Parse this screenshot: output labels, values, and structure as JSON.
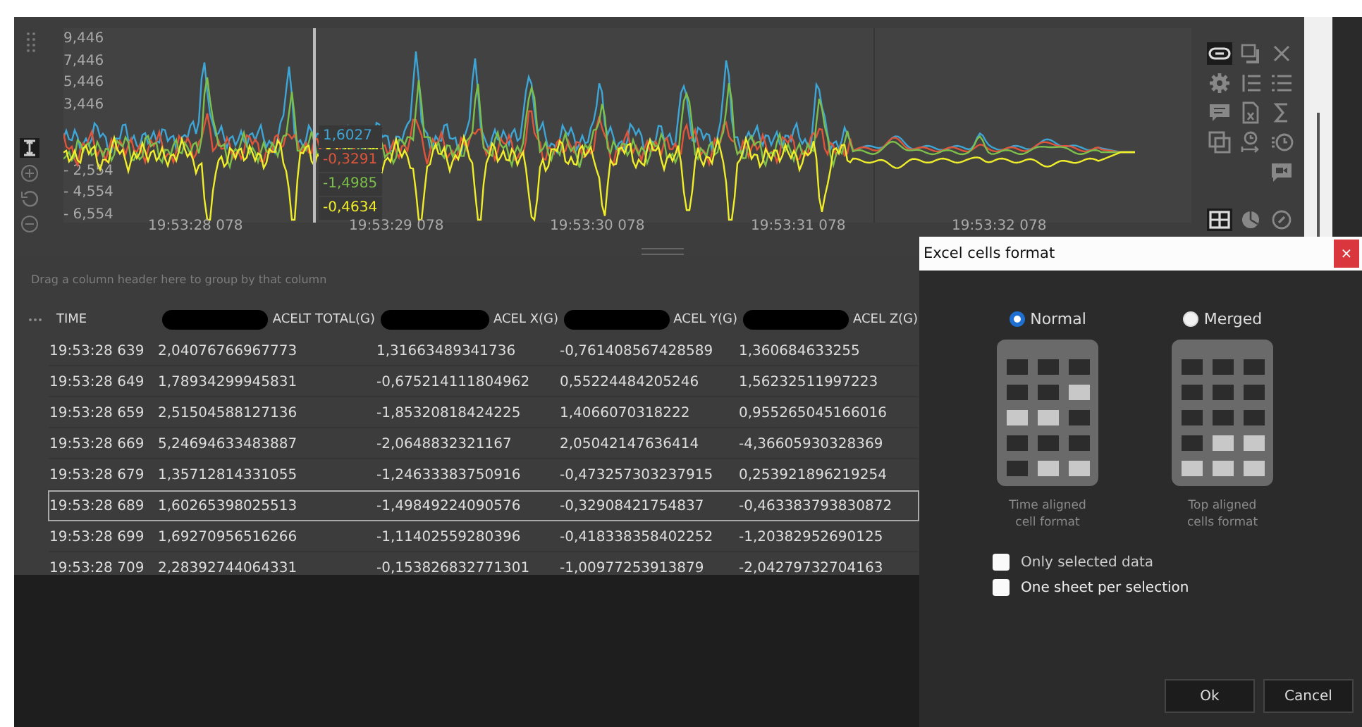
{
  "chart": {
    "y_labels": [
      "9,446",
      "7,446",
      "5,446",
      "3,446",
      "- 2,554",
      "- 4,554",
      "- 6,554"
    ],
    "x_labels": [
      "19:53:28 078",
      "19:53:29 078",
      "19:53:30 078",
      "19:53:31 078",
      "19:53:32 078"
    ],
    "series": [
      {
        "color": "#3ea6d6",
        "readout": "1,6027"
      },
      {
        "color": "#e0553a",
        "readout": "-0,3291"
      },
      {
        "color": "#7cbf4a",
        "readout": "-1,4985"
      },
      {
        "color": "#f0ee2a",
        "readout": "-0,4634"
      }
    ]
  },
  "tool_states": {
    "cursor": true,
    "link": true,
    "table_view": true
  },
  "group_hint": "Drag a column header here to group by that column",
  "columns": [
    {
      "label": "TIME",
      "redacted": false
    },
    {
      "label": "ACELT TOTAL(G)",
      "redacted": true
    },
    {
      "label": "ACEL X(G)",
      "redacted": true
    },
    {
      "label": "ACEL Y(G)",
      "redacted": true
    },
    {
      "label": "ACEL Z(G)",
      "redacted": true
    }
  ],
  "rows": [
    {
      "cells": [
        "19:53:28 639",
        "2,04076766967773",
        "1,31663489341736",
        "-0,761408567428589",
        "1,360684633255"
      ],
      "selected": false
    },
    {
      "cells": [
        "19:53:28 649",
        "1,78934299945831",
        "-0,675214111804962",
        "0,55224484205246",
        "1,56232511997223"
      ],
      "selected": false
    },
    {
      "cells": [
        "19:53:28 659",
        "2,51504588127136",
        "-1,85320818424225",
        "1,4066070318222",
        "0,955265045166016"
      ],
      "selected": false
    },
    {
      "cells": [
        "19:53:28 669",
        "5,24694633483887",
        "-2,0648832321167",
        "2,05042147636414",
        "-4,36605930328369"
      ],
      "selected": false
    },
    {
      "cells": [
        "19:53:28 679",
        "1,35712814331055",
        "-1,24633383750916",
        "-0,473257303237915",
        "0,253921896219254"
      ],
      "selected": false
    },
    {
      "cells": [
        "19:53:28 689",
        "1,60265398025513",
        "-1,49849224090576",
        "-0,32908421754837",
        "-0,463383793830872"
      ],
      "selected": true
    },
    {
      "cells": [
        "19:53:28 699",
        "1,69270956516266",
        "-1,11402559280396",
        "-0,418338358402252",
        "-1,20382952690125"
      ],
      "selected": false
    },
    {
      "cells": [
        "19:53:28 709",
        "2,28392744064331",
        "-0,153826832771301",
        "-1,00977253913879",
        "-2,04279732704163"
      ],
      "selected": false
    }
  ],
  "dialog": {
    "title": "Excel cells format",
    "close": "×",
    "formats": [
      {
        "label": "Normal",
        "selected": true,
        "caption": "Time aligned cell format",
        "kind": "normal"
      },
      {
        "label": "Merged",
        "selected": false,
        "caption": "Top aligned cells format",
        "kind": "merged"
      }
    ],
    "options": [
      {
        "label": "Only selected data",
        "checked": false
      },
      {
        "label": "One sheet per selection",
        "checked": false
      }
    ],
    "buttons": [
      "Ok",
      "Cancel"
    ]
  }
}
